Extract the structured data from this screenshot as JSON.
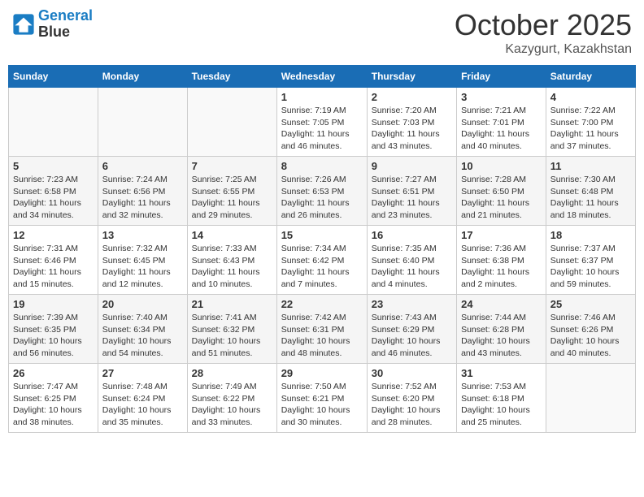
{
  "header": {
    "logo_line1": "General",
    "logo_line2": "Blue",
    "month": "October 2025",
    "location": "Kazygurt, Kazakhstan"
  },
  "days_of_week": [
    "Sunday",
    "Monday",
    "Tuesday",
    "Wednesday",
    "Thursday",
    "Friday",
    "Saturday"
  ],
  "weeks": [
    [
      {
        "day": "",
        "info": ""
      },
      {
        "day": "",
        "info": ""
      },
      {
        "day": "",
        "info": ""
      },
      {
        "day": "1",
        "info": "Sunrise: 7:19 AM\nSunset: 7:05 PM\nDaylight: 11 hours and 46 minutes."
      },
      {
        "day": "2",
        "info": "Sunrise: 7:20 AM\nSunset: 7:03 PM\nDaylight: 11 hours and 43 minutes."
      },
      {
        "day": "3",
        "info": "Sunrise: 7:21 AM\nSunset: 7:01 PM\nDaylight: 11 hours and 40 minutes."
      },
      {
        "day": "4",
        "info": "Sunrise: 7:22 AM\nSunset: 7:00 PM\nDaylight: 11 hours and 37 minutes."
      }
    ],
    [
      {
        "day": "5",
        "info": "Sunrise: 7:23 AM\nSunset: 6:58 PM\nDaylight: 11 hours and 34 minutes."
      },
      {
        "day": "6",
        "info": "Sunrise: 7:24 AM\nSunset: 6:56 PM\nDaylight: 11 hours and 32 minutes."
      },
      {
        "day": "7",
        "info": "Sunrise: 7:25 AM\nSunset: 6:55 PM\nDaylight: 11 hours and 29 minutes."
      },
      {
        "day": "8",
        "info": "Sunrise: 7:26 AM\nSunset: 6:53 PM\nDaylight: 11 hours and 26 minutes."
      },
      {
        "day": "9",
        "info": "Sunrise: 7:27 AM\nSunset: 6:51 PM\nDaylight: 11 hours and 23 minutes."
      },
      {
        "day": "10",
        "info": "Sunrise: 7:28 AM\nSunset: 6:50 PM\nDaylight: 11 hours and 21 minutes."
      },
      {
        "day": "11",
        "info": "Sunrise: 7:30 AM\nSunset: 6:48 PM\nDaylight: 11 hours and 18 minutes."
      }
    ],
    [
      {
        "day": "12",
        "info": "Sunrise: 7:31 AM\nSunset: 6:46 PM\nDaylight: 11 hours and 15 minutes."
      },
      {
        "day": "13",
        "info": "Sunrise: 7:32 AM\nSunset: 6:45 PM\nDaylight: 11 hours and 12 minutes."
      },
      {
        "day": "14",
        "info": "Sunrise: 7:33 AM\nSunset: 6:43 PM\nDaylight: 11 hours and 10 minutes."
      },
      {
        "day": "15",
        "info": "Sunrise: 7:34 AM\nSunset: 6:42 PM\nDaylight: 11 hours and 7 minutes."
      },
      {
        "day": "16",
        "info": "Sunrise: 7:35 AM\nSunset: 6:40 PM\nDaylight: 11 hours and 4 minutes."
      },
      {
        "day": "17",
        "info": "Sunrise: 7:36 AM\nSunset: 6:38 PM\nDaylight: 11 hours and 2 minutes."
      },
      {
        "day": "18",
        "info": "Sunrise: 7:37 AM\nSunset: 6:37 PM\nDaylight: 10 hours and 59 minutes."
      }
    ],
    [
      {
        "day": "19",
        "info": "Sunrise: 7:39 AM\nSunset: 6:35 PM\nDaylight: 10 hours and 56 minutes."
      },
      {
        "day": "20",
        "info": "Sunrise: 7:40 AM\nSunset: 6:34 PM\nDaylight: 10 hours and 54 minutes."
      },
      {
        "day": "21",
        "info": "Sunrise: 7:41 AM\nSunset: 6:32 PM\nDaylight: 10 hours and 51 minutes."
      },
      {
        "day": "22",
        "info": "Sunrise: 7:42 AM\nSunset: 6:31 PM\nDaylight: 10 hours and 48 minutes."
      },
      {
        "day": "23",
        "info": "Sunrise: 7:43 AM\nSunset: 6:29 PM\nDaylight: 10 hours and 46 minutes."
      },
      {
        "day": "24",
        "info": "Sunrise: 7:44 AM\nSunset: 6:28 PM\nDaylight: 10 hours and 43 minutes."
      },
      {
        "day": "25",
        "info": "Sunrise: 7:46 AM\nSunset: 6:26 PM\nDaylight: 10 hours and 40 minutes."
      }
    ],
    [
      {
        "day": "26",
        "info": "Sunrise: 7:47 AM\nSunset: 6:25 PM\nDaylight: 10 hours and 38 minutes."
      },
      {
        "day": "27",
        "info": "Sunrise: 7:48 AM\nSunset: 6:24 PM\nDaylight: 10 hours and 35 minutes."
      },
      {
        "day": "28",
        "info": "Sunrise: 7:49 AM\nSunset: 6:22 PM\nDaylight: 10 hours and 33 minutes."
      },
      {
        "day": "29",
        "info": "Sunrise: 7:50 AM\nSunset: 6:21 PM\nDaylight: 10 hours and 30 minutes."
      },
      {
        "day": "30",
        "info": "Sunrise: 7:52 AM\nSunset: 6:20 PM\nDaylight: 10 hours and 28 minutes."
      },
      {
        "day": "31",
        "info": "Sunrise: 7:53 AM\nSunset: 6:18 PM\nDaylight: 10 hours and 25 minutes."
      },
      {
        "day": "",
        "info": ""
      }
    ]
  ]
}
